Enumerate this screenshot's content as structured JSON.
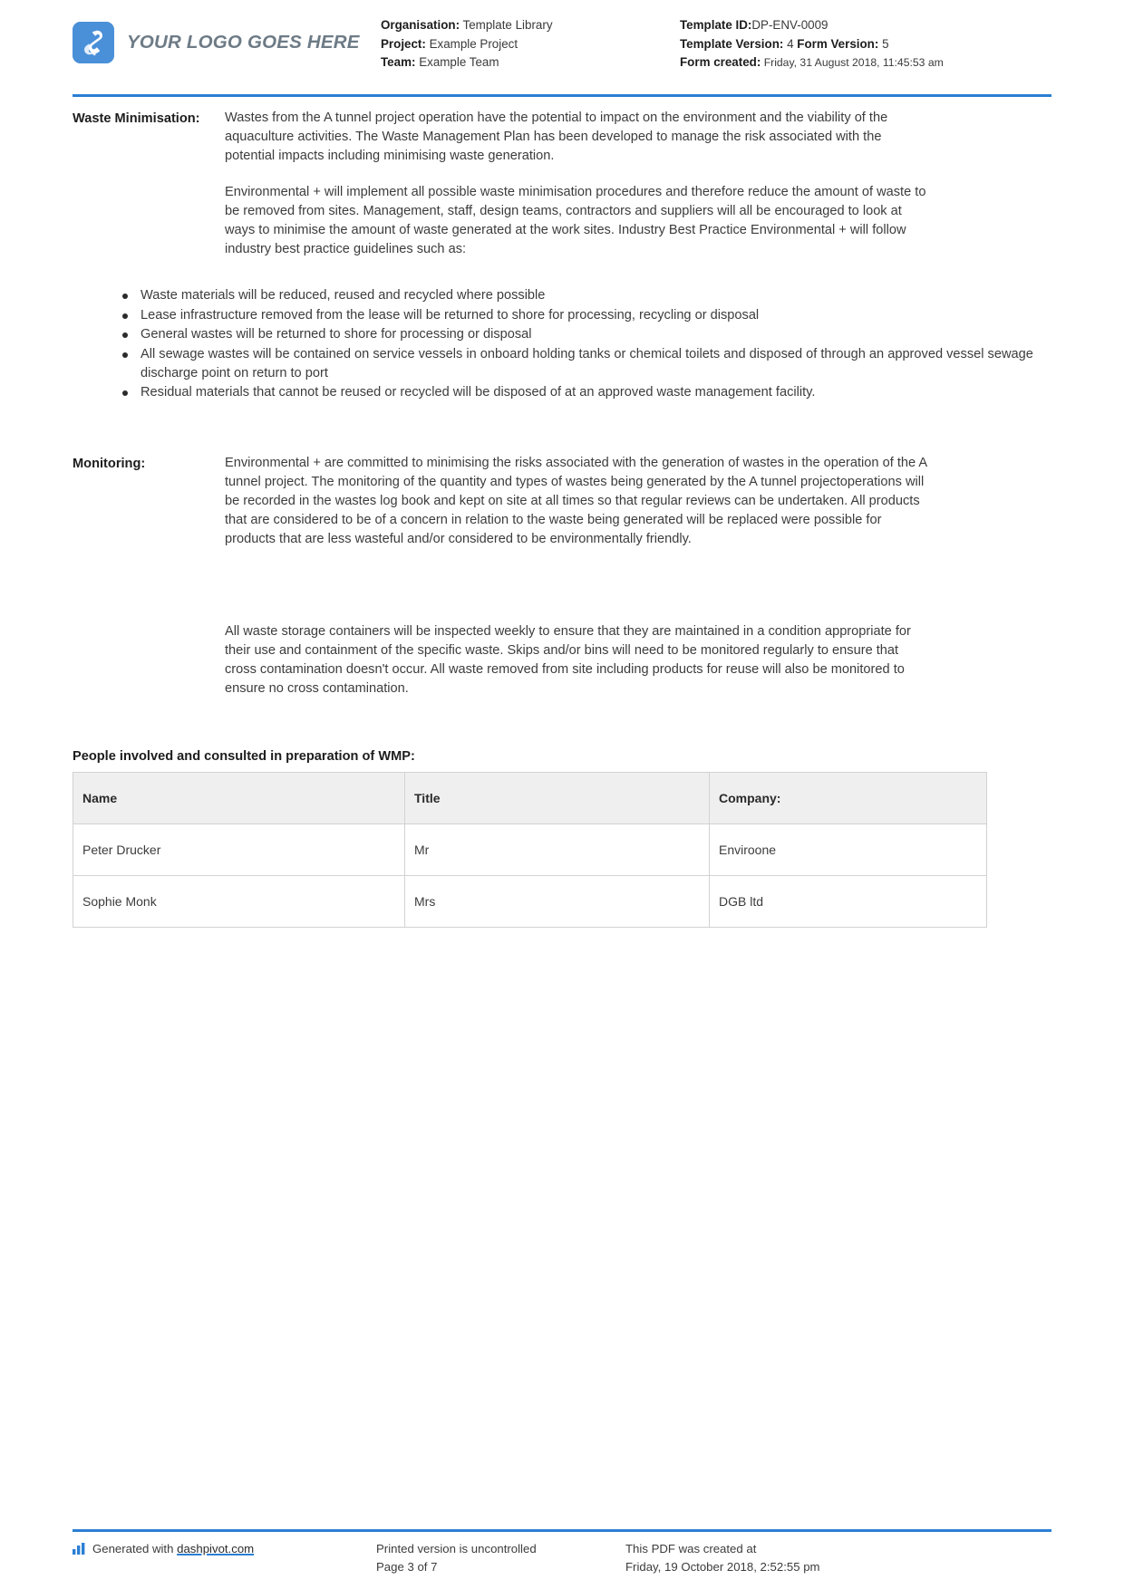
{
  "header": {
    "logo_text": "YOUR LOGO GOES HERE",
    "organisation_label": "Organisation:",
    "organisation_value": "Template Library",
    "project_label": "Project:",
    "project_value": "Example Project",
    "team_label": "Team:",
    "team_value": "Example Team",
    "template_id_label": "Template ID:",
    "template_id_value": "DP-ENV-0009",
    "template_version_label": "Template Version:",
    "template_version_value": "4",
    "form_version_label": "Form Version:",
    "form_version_value": "5",
    "form_created_label": "Form created:",
    "form_created_value": "Friday, 31 August 2018, 11:45:53 am"
  },
  "sections": {
    "waste_minimisation": {
      "label": "Waste Minimisation:",
      "paragraph_1": "Wastes from the A tunnel project operation have the potential to impact on the environment and the viability of the aquaculture activities. The Waste Management Plan has been developed to manage the risk associated with the potential impacts including minimising waste generation.",
      "paragraph_2": "Environmental + will implement all possible waste minimisation procedures and therefore reduce the amount of waste to be removed from sites. Management, staff, design teams, contractors and suppliers will all be encouraged to look at ways to minimise the amount of waste generated at the work sites. Industry Best Practice Environmental + will follow industry best practice guidelines such as:",
      "bullets": [
        "Waste materials will be reduced, reused and recycled where possible",
        "Lease infrastructure removed from the lease will be returned to shore for processing, recycling or disposal",
        "General wastes will be returned to shore for processing or disposal",
        "All sewage wastes will be contained on service vessels in onboard holding tanks or chemical toilets and disposed of through an approved vessel sewage discharge point on return to port",
        "Residual materials that cannot be reused or recycled will be disposed of at an approved waste management facility."
      ]
    },
    "monitoring": {
      "label": "Monitoring:",
      "paragraph_1": "Environmental + are committed to minimising the risks associated with the generation of wastes in the operation of the A tunnel project. The monitoring of the quantity and types of wastes being generated by the A tunnel projectoperations will be recorded in the wastes log book and kept on site at all times so that regular reviews can be undertaken. All products that are considered to be of a concern in relation to the waste being generated will be replaced were possible for products that are less wasteful and/or considered to be environmentally friendly.",
      "paragraph_2": "All waste storage containers will be inspected weekly to ensure that they are maintained in a condition appropriate for their use and containment of the specific waste. Skips and/or bins will need to be monitored regularly to ensure that cross contamination doesn't occur. All waste removed from site including products for reuse will also be monitored to ensure no cross contamination."
    }
  },
  "people_table": {
    "heading": "People involved and consulted in preparation of WMP:",
    "columns": [
      "Name",
      "Title",
      "Company:"
    ],
    "rows": [
      {
        "name": "Peter Drucker",
        "title": "Mr",
        "company": "Enviroone"
      },
      {
        "name": "Sophie Monk",
        "title": "Mrs",
        "company": "DGB ltd"
      }
    ]
  },
  "footer": {
    "generated_prefix": "Generated with ",
    "generated_link": "dashpivot.com",
    "printed_notice": "Printed version is uncontrolled",
    "page_number": "Page 3 of 7",
    "created_notice": "This PDF was created at",
    "created_timestamp": "Friday, 19 October 2018, 2:52:55 pm"
  },
  "colors": {
    "accent": "#2b7fd4",
    "logo_blue": "#4a90d9",
    "table_header_bg": "#efefef"
  }
}
